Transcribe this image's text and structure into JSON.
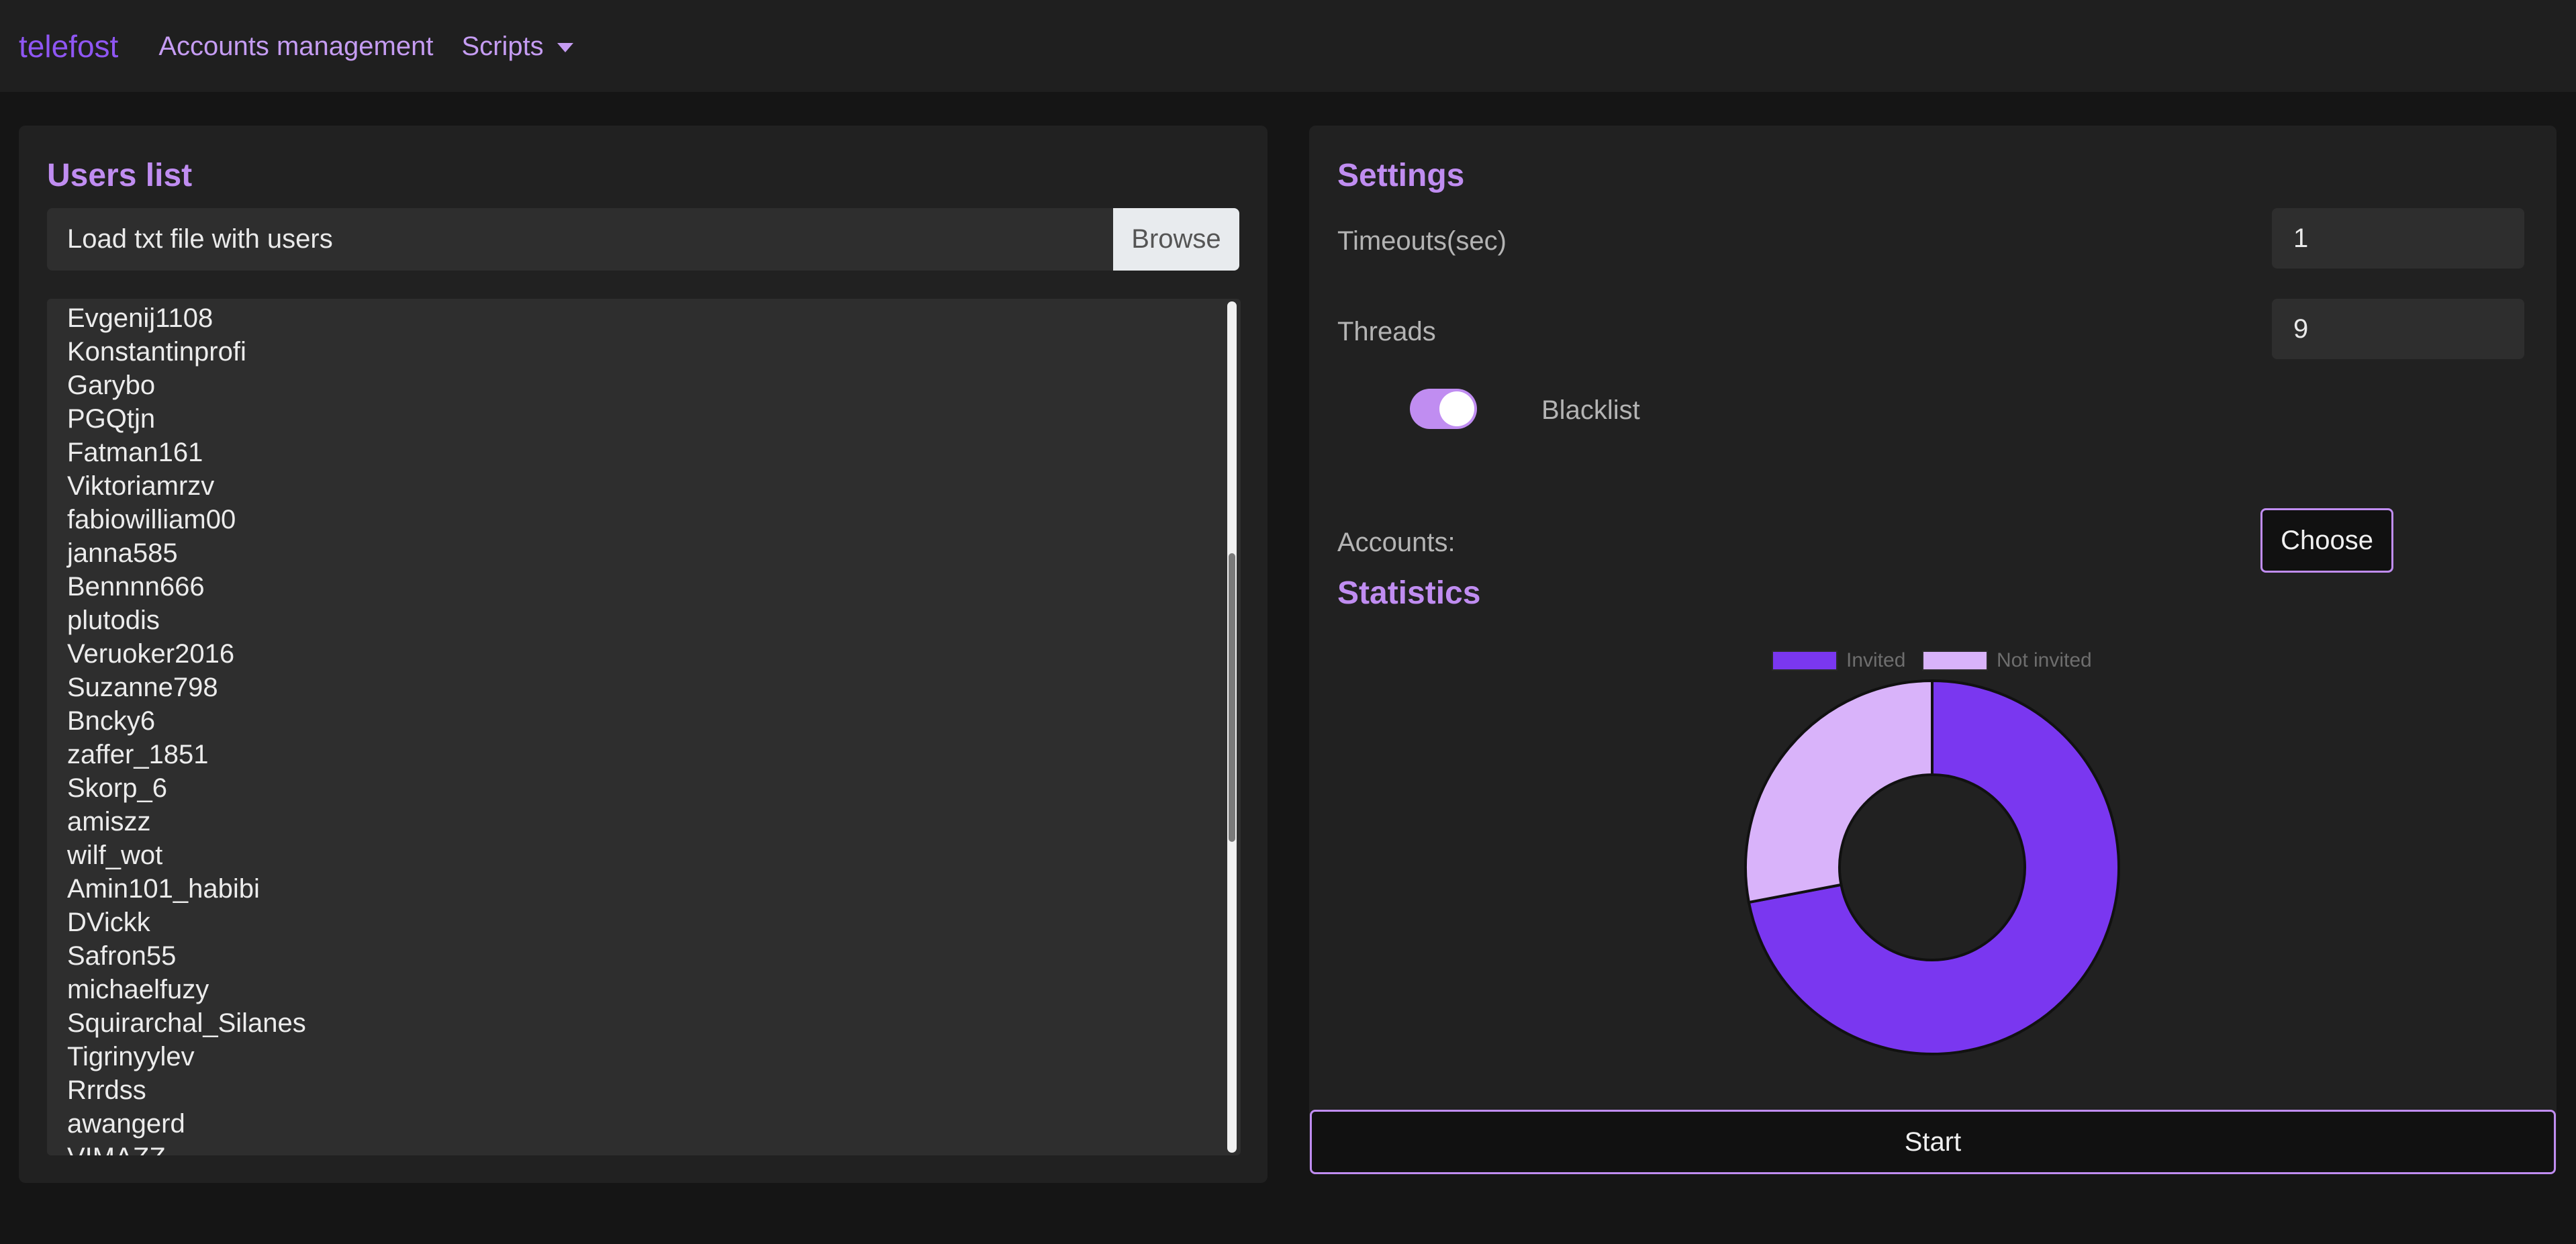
{
  "navbar": {
    "brand": "telefost",
    "links": [
      {
        "label": "Accounts management"
      },
      {
        "label": "Scripts"
      }
    ]
  },
  "users_panel": {
    "title": "Users list",
    "file_label": "Load txt file with users",
    "browse_label": "Browse",
    "users": [
      "Evgenij1108",
      "Konstantinprofi",
      "Garybo",
      "PGQtjn",
      "Fatman161",
      "Viktoriamrzv",
      "fabiowilliam00",
      "janna585",
      "Bennnn666",
      "plutodis",
      "Veruoker2016",
      "Suzanne798",
      "Bncky6",
      "zaffer_1851",
      "Skorp_6",
      "amiszz",
      "wilf_wot",
      "Amin101_habibi",
      "DVickk",
      "Safron55",
      "michaelfuzy",
      "Squirarchal_Silanes",
      "Tigrinyylev",
      "Rrrdss",
      "awangerd",
      "VIMAZZ"
    ]
  },
  "settings_panel": {
    "title": "Settings",
    "timeouts_label": "Timeouts(sec)",
    "timeouts_value": "1",
    "threads_label": "Threads",
    "threads_value": "9",
    "blacklist_label": "Blacklist",
    "blacklist_enabled": true,
    "accounts_label": "Accounts:",
    "choose_label": "Choose"
  },
  "statistics": {
    "title": "Statistics"
  },
  "chart_data": {
    "type": "pie",
    "donut": true,
    "categories": [
      "Invited",
      "Not invited"
    ],
    "values": [
      72,
      28
    ],
    "colors": [
      "#7a37f0",
      "#d9b3fa"
    ],
    "legend_position": "top"
  },
  "start_label": "Start",
  "colors": {
    "accent": "#c08df1",
    "brand": "#8f56f4",
    "invited": "#7a37f0",
    "not_invited": "#d9b3fa"
  }
}
